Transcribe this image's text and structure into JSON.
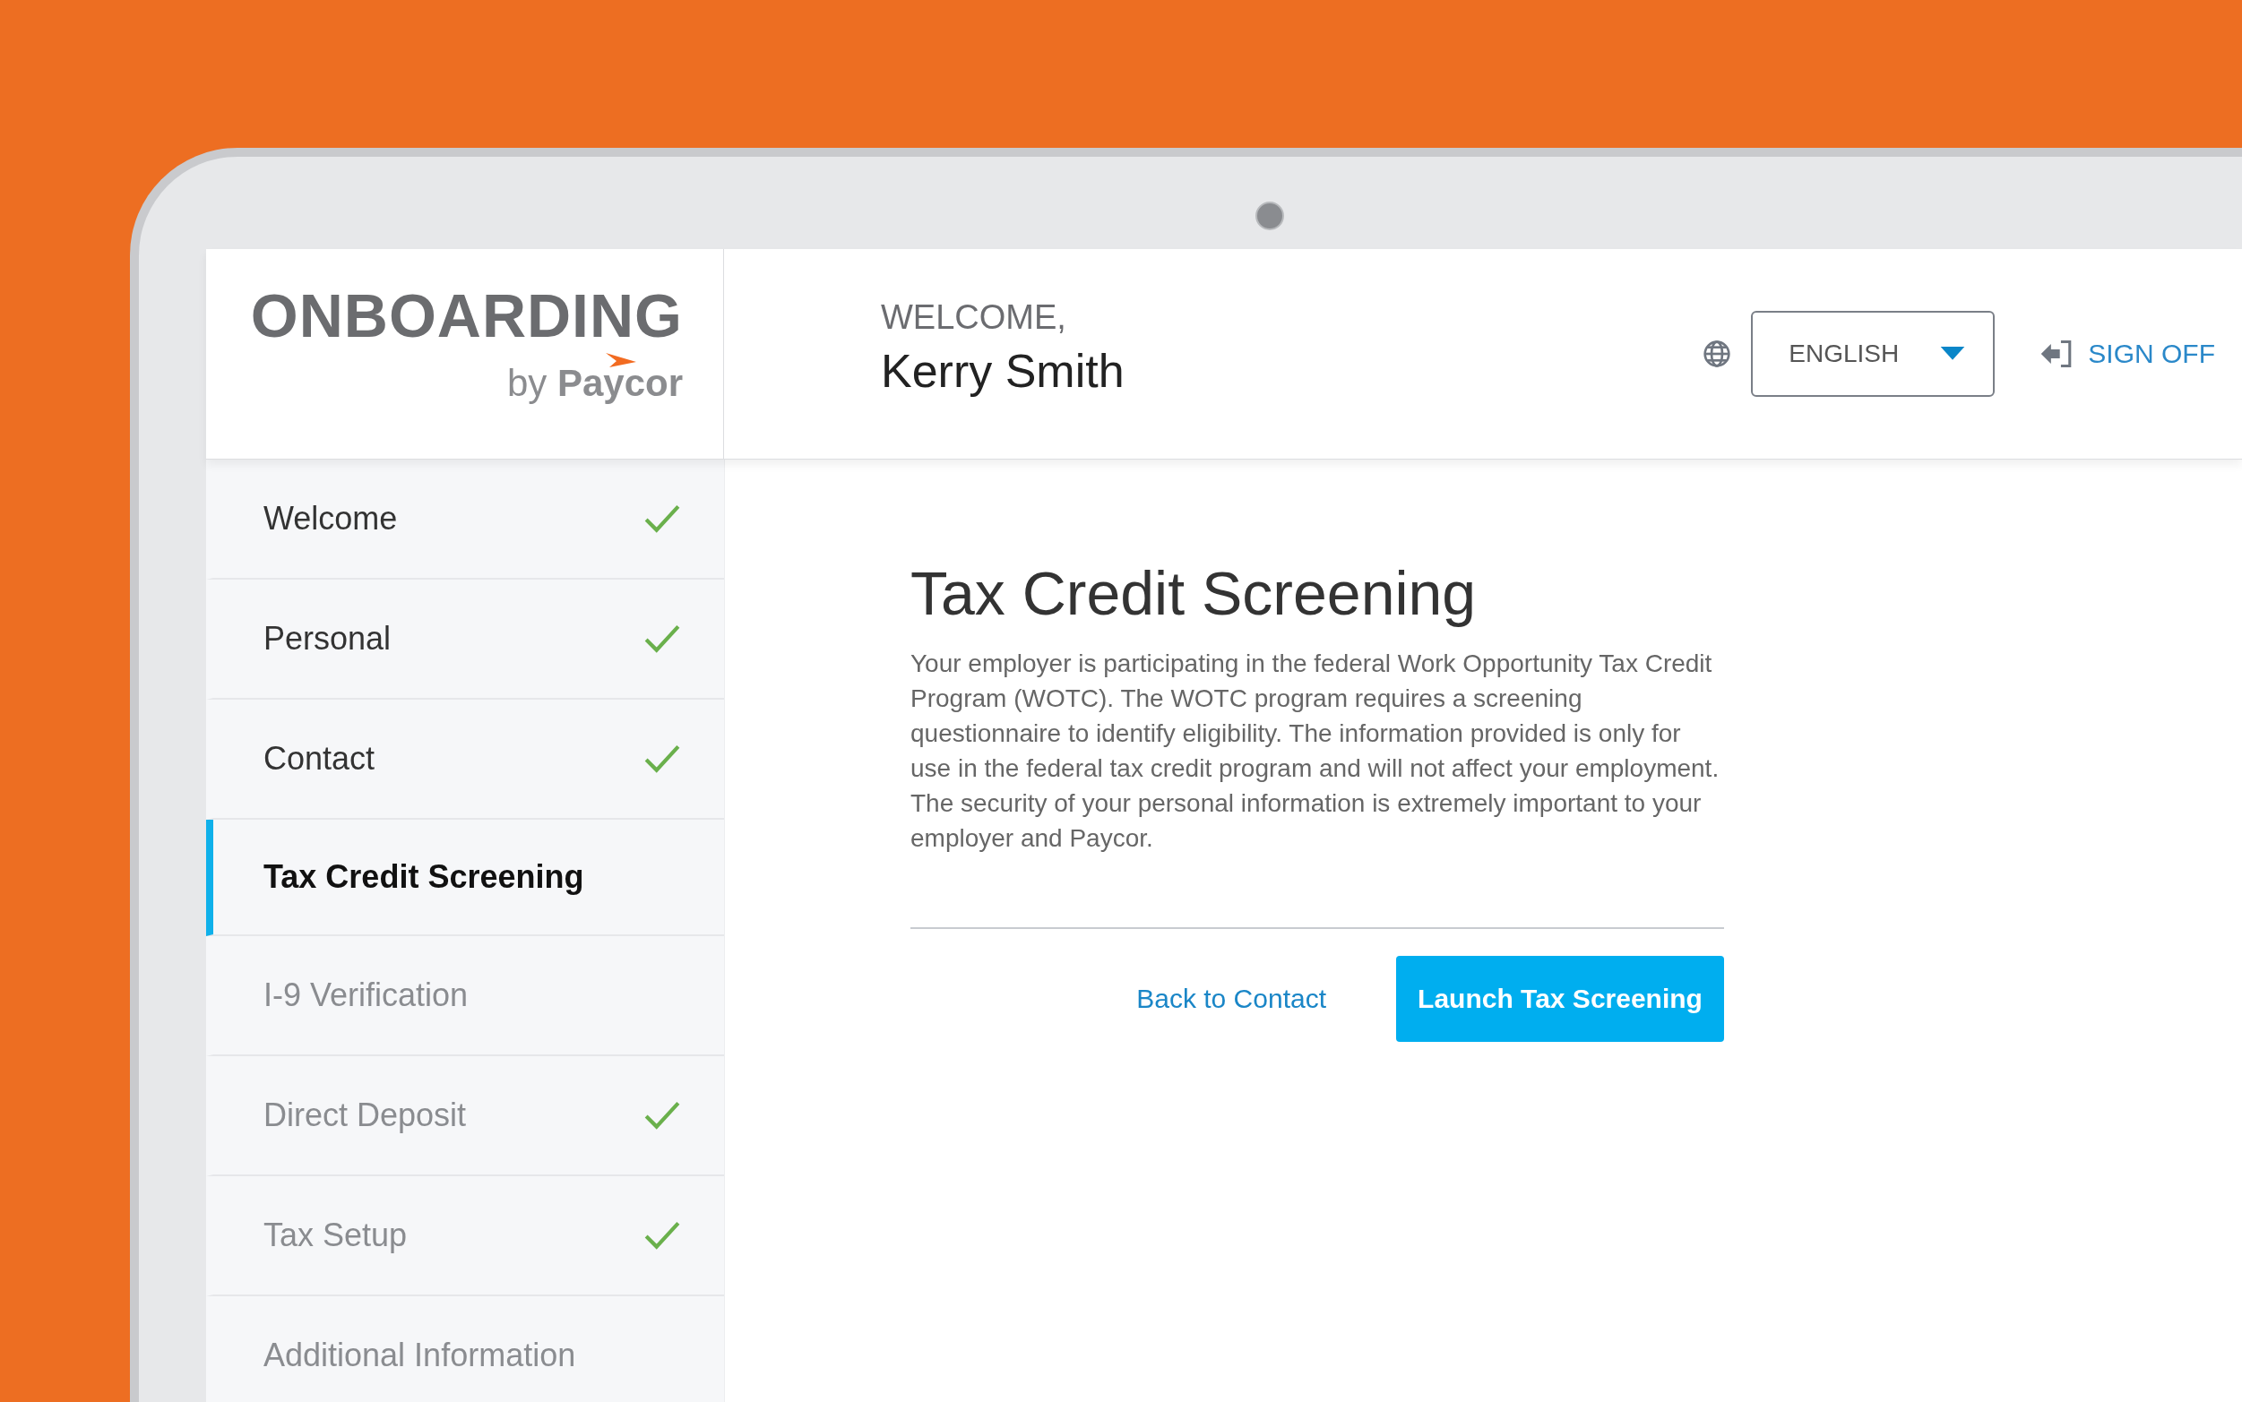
{
  "logo": {
    "title": "ONBOARDING",
    "byline": "by **Paycor**"
  },
  "header": {
    "greeting": "WELCOME,",
    "user_name": "Kerry Smith",
    "language": "ENGLISH",
    "sign_off": "SIGN OFF"
  },
  "nav": [
    {
      "label": "Welcome",
      "completed": true,
      "selected": false,
      "dimmed": false
    },
    {
      "label": "Personal",
      "completed": true,
      "selected": false,
      "dimmed": false
    },
    {
      "label": "Contact",
      "completed": true,
      "selected": false,
      "dimmed": false
    },
    {
      "label": "Tax Credit Screening",
      "completed": false,
      "selected": true,
      "dimmed": false
    },
    {
      "label": "I-9 Verification",
      "completed": false,
      "selected": false,
      "dimmed": true
    },
    {
      "label": "Direct Deposit",
      "completed": true,
      "selected": false,
      "dimmed": true
    },
    {
      "label": "Tax Setup",
      "completed": true,
      "selected": false,
      "dimmed": true
    },
    {
      "label": "Additional Information",
      "completed": false,
      "selected": false,
      "dimmed": true
    }
  ],
  "content": {
    "title": "Tax Credit Screening",
    "body": "Your employer is participating in the federal Work Opportunity Tax Credit Program (WOTC). The WOTC program requires a screening questionnaire to identify eligibility. The information provided is only for use in the federal tax credit program and will not affect your employment. The security of your personal information is extremely important to your employer and Paycor.",
    "back_link": "Back to Contact",
    "primary_button": "Launch Tax Screening"
  }
}
